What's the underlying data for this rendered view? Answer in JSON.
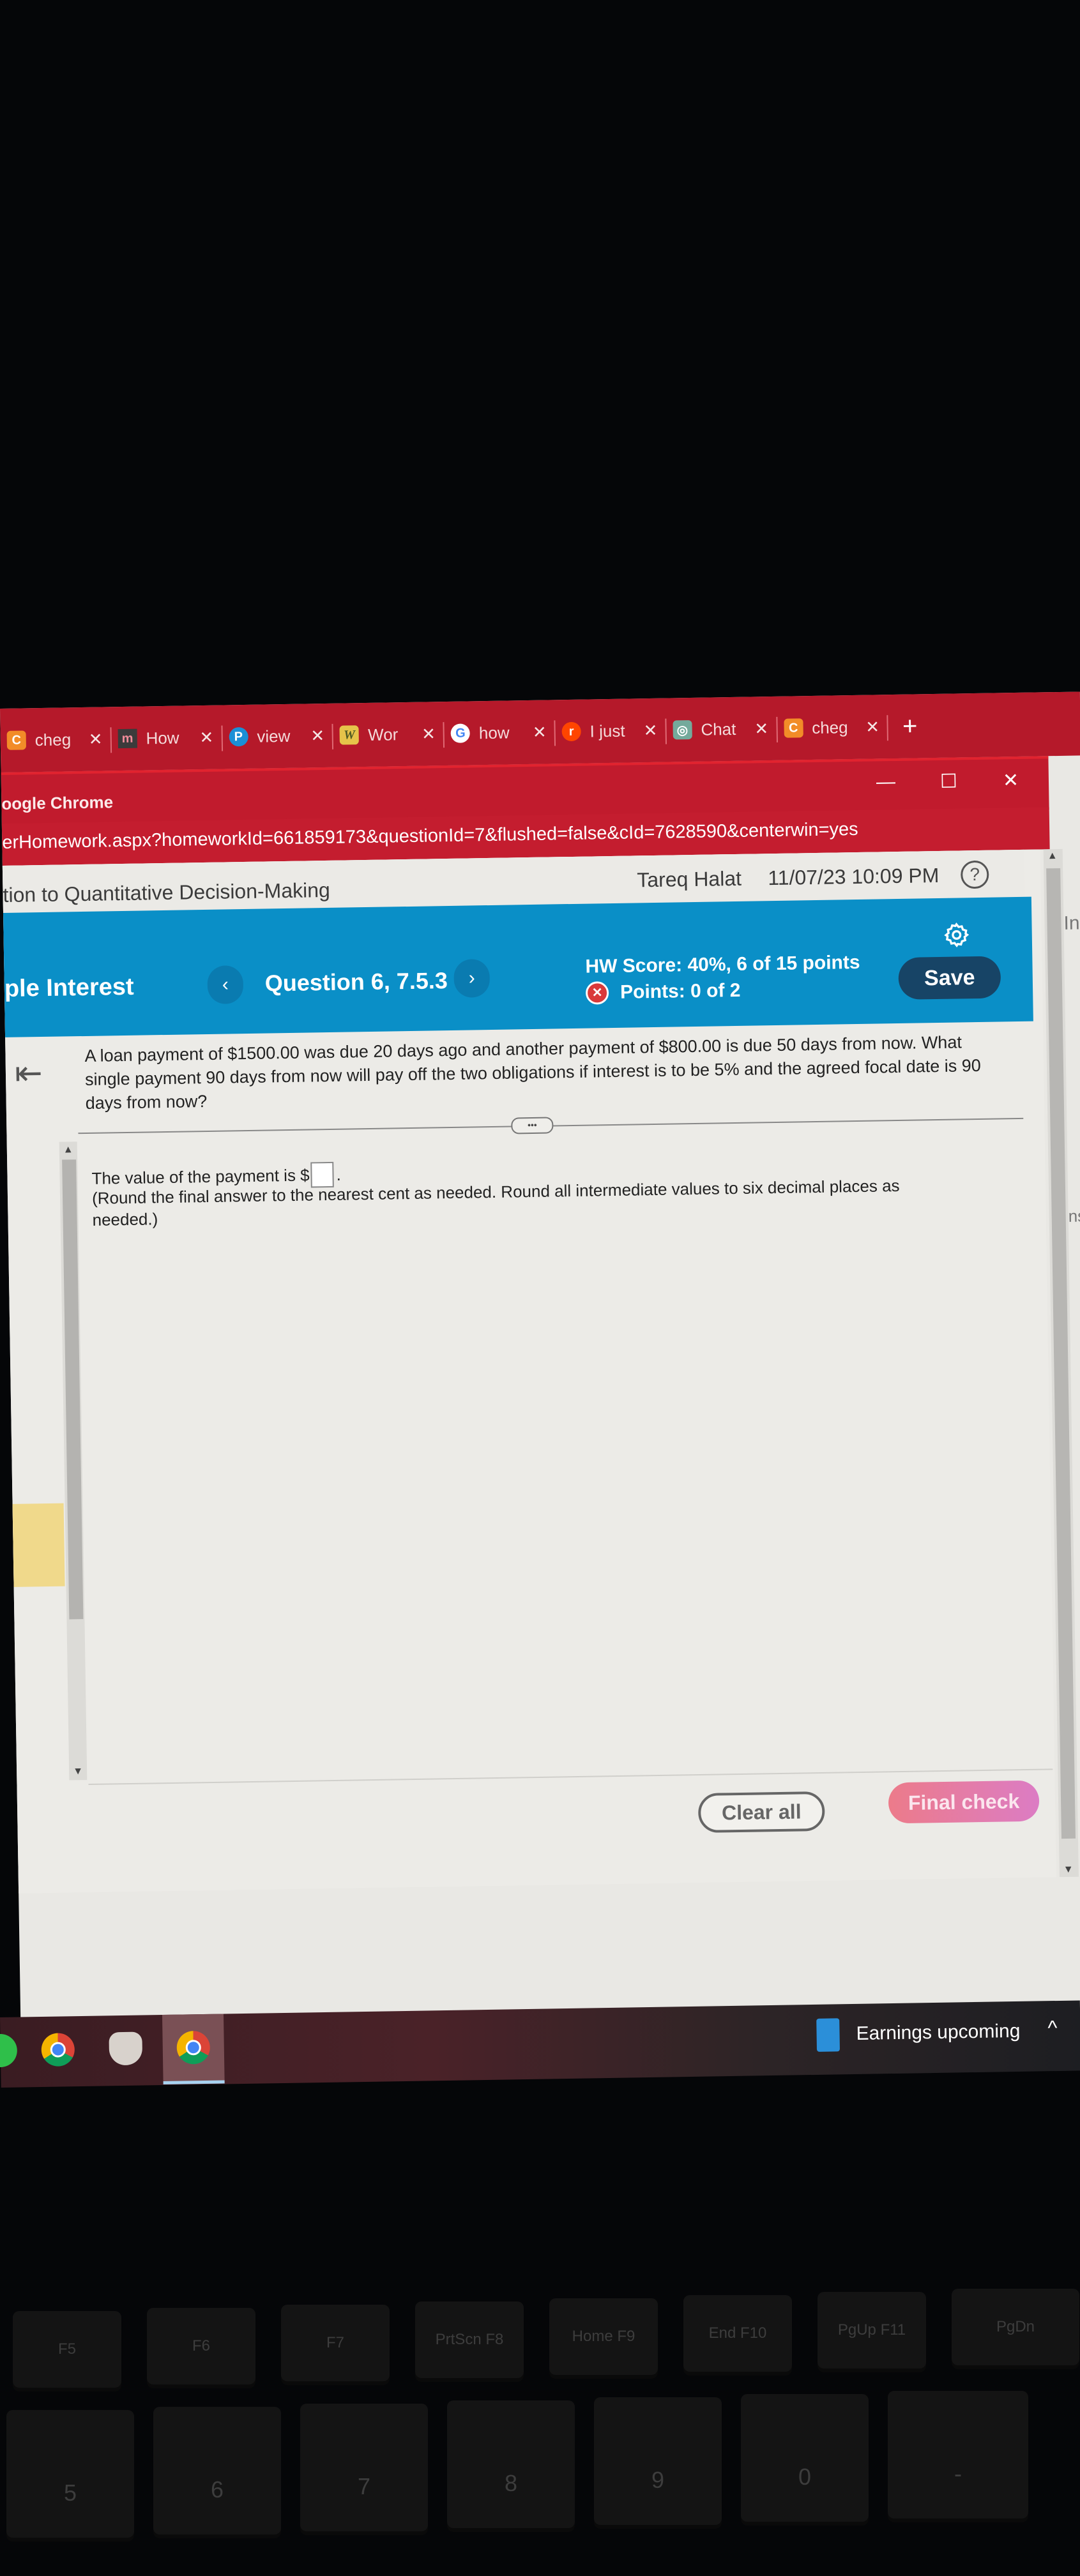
{
  "browser": {
    "tabs": [
      {
        "title": "cheg",
        "favicon": "chegg-icon",
        "color": "#f28c28",
        "glyph": "C"
      },
      {
        "title": "How",
        "favicon": "m-icon",
        "color": "#3b3b3b",
        "glyph": "m"
      },
      {
        "title": "view",
        "favicon": "pearson-icon",
        "color": "#1b8fd6",
        "glyph": "P"
      },
      {
        "title": "Wor",
        "favicon": "w-icon",
        "color": "#e6c34a",
        "glyph": "W"
      },
      {
        "title": "how",
        "favicon": "google-icon",
        "color": "#ffffff",
        "glyph": "G"
      },
      {
        "title": "I just",
        "favicon": "reddit-icon",
        "color": "#ff4500",
        "glyph": "r"
      },
      {
        "title": "Chat",
        "favicon": "chatgpt-icon",
        "color": "#74aa9c",
        "glyph": "◎"
      },
      {
        "title": "cheg",
        "favicon": "chegg-icon",
        "color": "#f28c28",
        "glyph": "C"
      }
    ],
    "close_glyph": "✕",
    "new_tab": "+",
    "window_title": "oogle Chrome",
    "url": "erHomework.aspx?homeworkId=661859173&questionId=7&flushed=false&cId=7628590&centerwin=yes",
    "window_controls": {
      "minimize": "—",
      "maximize": "☐",
      "close": "✕"
    }
  },
  "header": {
    "course_title": "tion to Quantitative Decision-Making",
    "user_name": "Tareq Halat",
    "datetime": "11/07/23 10:09 PM",
    "help": "?"
  },
  "question_bar": {
    "section_title": "ple Interest",
    "prev": "‹",
    "next": "›",
    "question_label": "Question 6, 7.5.3",
    "hw_score": "HW Score: 40%, 6 of 15 points",
    "points": "Points: 0 of 2",
    "save_label": "Save"
  },
  "question": {
    "text": "A loan payment of $1500.00 was due 20 days ago and another payment of $800.00 is due 50 days from now. What single payment 90 days from now will pay off the two obligations if interest is to be 5% and the agreed focal date is 90 days from now?",
    "handle": "•••",
    "answer_prefix": "The value of the payment is $",
    "answer_value": "",
    "answer_suffix": ".",
    "hint": "(Round the final answer to the nearest cent as needed. Round all intermediate values to six decimal places as needed.)"
  },
  "actions": {
    "clear_all": "Clear all",
    "final_check": "Final check"
  },
  "side_panel": {
    "top_text": "Inc",
    "mid_text": "ns,"
  },
  "taskbar": {
    "earnings": "Earnings upcoming",
    "chevron": "^"
  },
  "keyboard": {
    "fkeys": [
      "F5",
      "F6",
      "F7",
      "PrtScn F8",
      "Home F9",
      "End F10",
      "PgUp F11",
      "PgDn"
    ],
    "numkeys": [
      "5",
      "6",
      "7",
      "8",
      "9",
      "0",
      "-"
    ]
  }
}
